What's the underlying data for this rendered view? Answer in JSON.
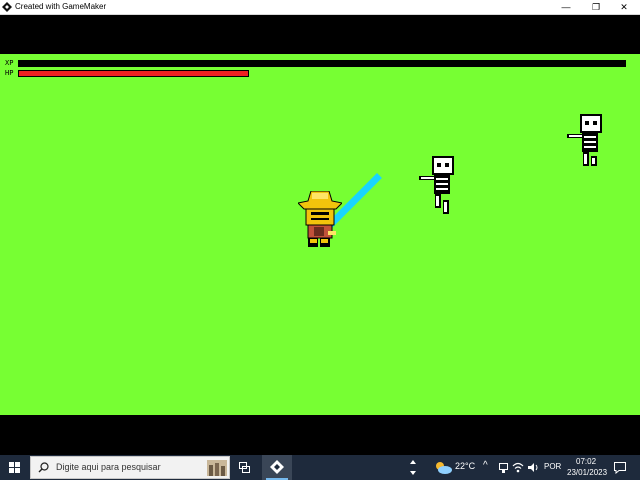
{
  "window": {
    "title": "Created with GameMaker",
    "controls": {
      "minimize": "—",
      "maximize": "❐",
      "close": "✕"
    }
  },
  "hud": {
    "xp": {
      "label": "XP",
      "value": 0,
      "color": "#000000"
    },
    "hp": {
      "label": "HP",
      "value": 0.38,
      "color": "#ee2222"
    }
  },
  "game": {
    "background": "#77ff33",
    "player": {
      "sprite": "golden-helmet-knight",
      "weapon": "cyan-energy-sword"
    },
    "enemies": [
      {
        "sprite": "skeleton"
      },
      {
        "sprite": "skeleton"
      }
    ]
  },
  "taskbar": {
    "start_icon": "windows-icon",
    "search_placeholder": "Digite aqui para pesquisar",
    "task_view_icon": "task-view-icon",
    "pinned_app_icon": "gamemaker-icon",
    "weather": {
      "temp": "22°C",
      "icon": "cloud-sun-icon"
    },
    "language": "POR",
    "time": "07:02",
    "date": "23/01/2023"
  }
}
